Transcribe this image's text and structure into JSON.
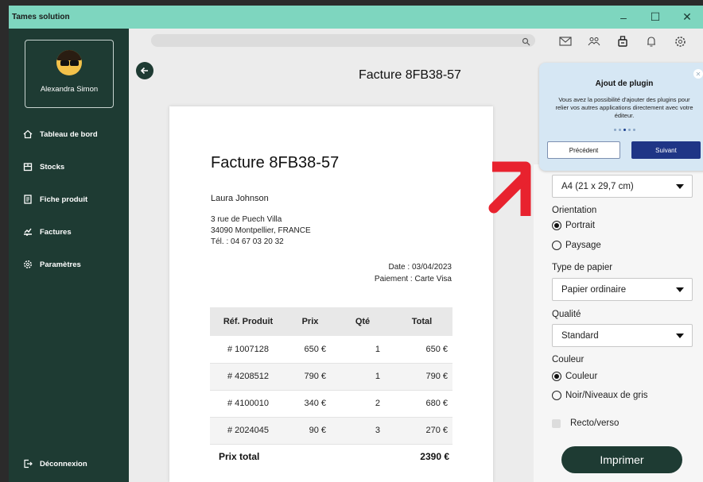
{
  "app": {
    "title": "Tames solution"
  },
  "window_controls": {
    "minimize": "–",
    "maximize": "☐",
    "close": "✕"
  },
  "user": {
    "name": "Alexandra Simon"
  },
  "sidebar": {
    "items": [
      {
        "label": "Tableau de bord",
        "icon": "home-icon"
      },
      {
        "label": "Stocks",
        "icon": "box-icon"
      },
      {
        "label": "Fiche produit",
        "icon": "document-icon"
      },
      {
        "label": "Factures",
        "icon": "invoice-icon"
      },
      {
        "label": "Paramètres",
        "icon": "gear-icon"
      }
    ],
    "logout": "Déconnexion"
  },
  "topbar": {
    "icons": [
      "mail-icon",
      "users-icon",
      "plugin-icon",
      "bell-icon",
      "settings-icon"
    ]
  },
  "header": {
    "title": "Facture 8FB38-57"
  },
  "invoice": {
    "title": "Facture 8FB38-57",
    "client": "Laura Johnson",
    "address_line1": "3 rue de Puech Villa",
    "address_line2": "34090 Montpellier, FRANCE",
    "phone": "Tél. : 04 67 03 20 32",
    "date": "Date : 03/04/2023",
    "payment": "Paiement : Carte Visa",
    "columns": [
      "Réf. Produit",
      "Prix",
      "Qté",
      "Total"
    ],
    "rows": [
      {
        "ref": "# 1007128",
        "price": "650 €",
        "qty": "1",
        "total": "650 €"
      },
      {
        "ref": "# 4208512",
        "price": "790 €",
        "qty": "1",
        "total": "790 €"
      },
      {
        "ref": "# 4100010",
        "price": "340 €",
        "qty": "2",
        "total": "680 €"
      },
      {
        "ref": "# 2024045",
        "price": "90 €",
        "qty": "3",
        "total": "270 €"
      }
    ],
    "total_label": "Prix total",
    "total_value": "2390 €"
  },
  "print": {
    "paper_size": "A4 (21 x 29,7 cm)",
    "orientation_label": "Orientation",
    "orientation_portrait": "Portrait",
    "orientation_landscape": "Paysage",
    "paper_type_label": "Type de papier",
    "paper_type": "Papier ordinaire",
    "quality_label": "Qualité",
    "quality": "Standard",
    "color_label": "Couleur",
    "color_option": "Couleur",
    "grayscale_option": "Noir/Niveaux de gris",
    "duplex": "Recto/verso",
    "print_button": "Imprimer"
  },
  "tooltip": {
    "title": "Ajout de plugin",
    "text": "Vous avez la possibilité d'ajouter des plugins pour relier vos autres applications directement avec votre éditeur.",
    "prev": "Précédent",
    "next": "Suivant",
    "step": 3,
    "steps": 5
  },
  "colors": {
    "sidebar": "#1e3b33",
    "titlebar": "#7ed6bf",
    "accent": "#1f3586",
    "arrow": "#e8222e"
  }
}
